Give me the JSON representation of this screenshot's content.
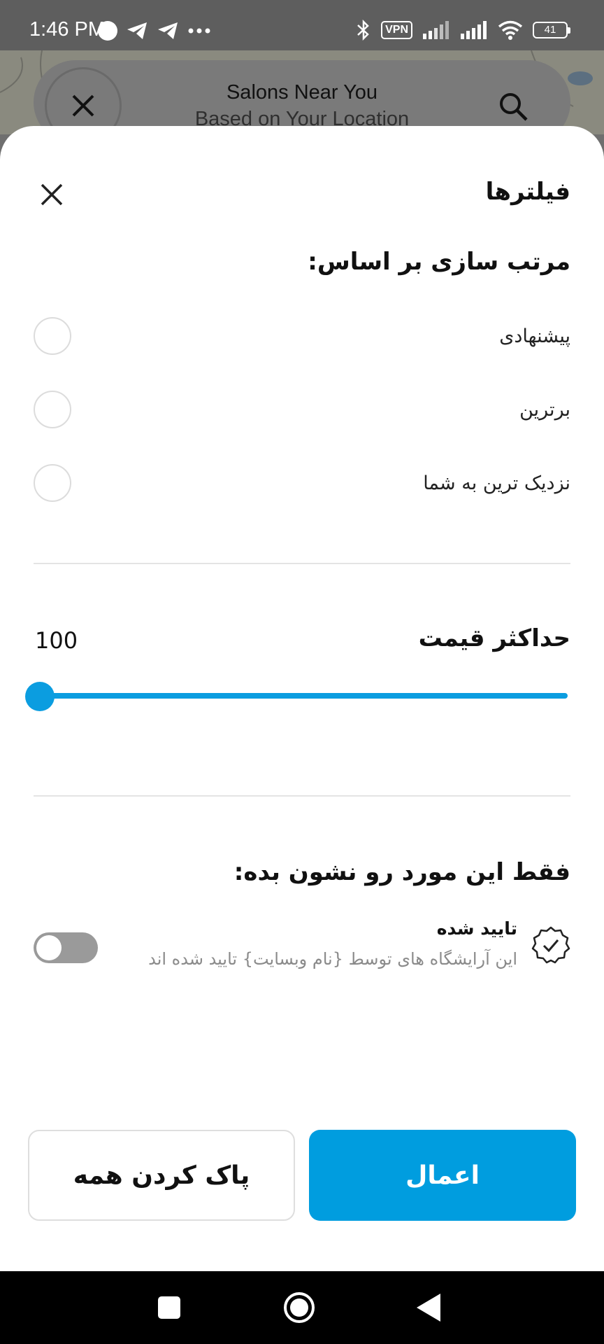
{
  "status_bar": {
    "time": "1:46 PM",
    "vpn": "VPN",
    "battery": "41",
    "icons": [
      "circle-icon",
      "telegram-icon",
      "telegram-icon",
      "more-icon",
      "bluetooth-icon",
      "vpn-icon",
      "signal-icon",
      "signal-icon",
      "wifi-icon",
      "battery-icon"
    ]
  },
  "header": {
    "title": "Salons Near You",
    "subtitle": "Based on Your Location"
  },
  "sheet": {
    "title": "فیلترها",
    "sort_heading": "مرتب سازی بر اساس:",
    "sort_options": [
      {
        "label": "پیشنهادی",
        "selected": false
      },
      {
        "label": "برترین",
        "selected": false
      },
      {
        "label": "نزدیک ترین به شما",
        "selected": false
      }
    ],
    "price_heading": "حداکثر قیمت",
    "price_value": "100",
    "price_level": 0.0,
    "show_heading": "فقط این مورد رو نشون بده:",
    "verified": {
      "title": "تایید شده",
      "description": "این آرایشگاه های توسط {نام وبسایت} تایید شده اند",
      "enabled": false
    },
    "apply_label": "اعمال",
    "clear_label": "پاک کردن همه"
  },
  "colors": {
    "accent": "#009ddf",
    "sheet_background": "#ffffff",
    "overlay": "#6f6f6f"
  }
}
